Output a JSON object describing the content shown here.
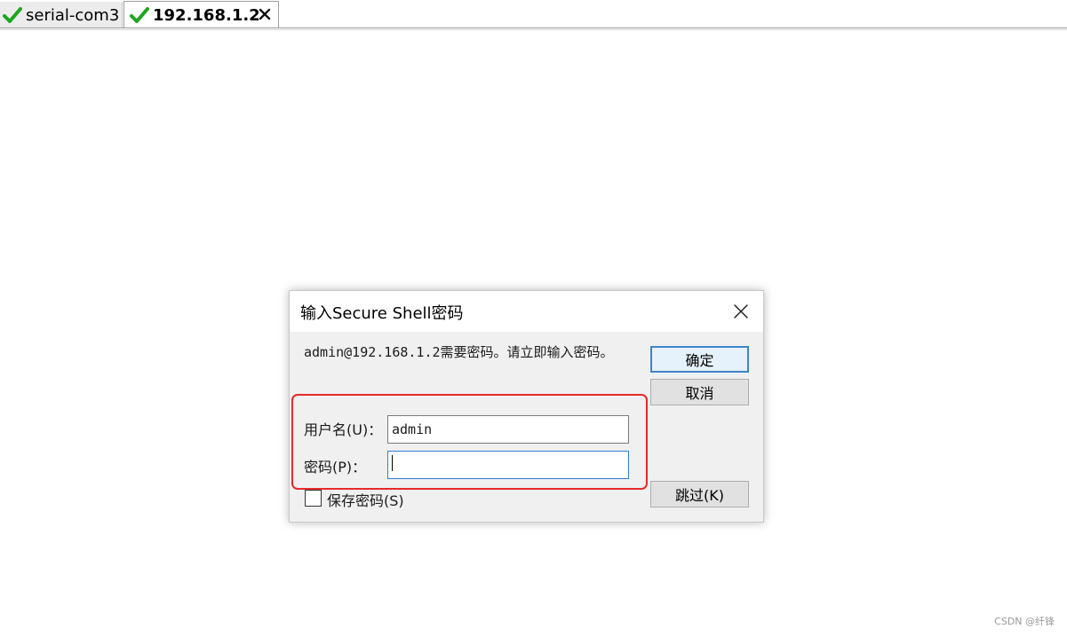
{
  "tabs": [
    {
      "label": "serial-com3",
      "status_icon": "check-icon",
      "active": false
    },
    {
      "label": "192.168.1.2",
      "status_icon": "check-icon",
      "active": true,
      "close_icon": "close-icon"
    }
  ],
  "dialog": {
    "title": "输入Secure Shell密码",
    "close_icon": "close-icon",
    "message": "admin@192.168.1.2需要密码。请立即输入密码。",
    "username_label": "用户名(U)：",
    "username_value": "admin",
    "password_label": "密码(P)：",
    "password_value": "",
    "save_password_label": "保存密码(S)",
    "save_password_checked": false,
    "ok_label": "确定",
    "cancel_label": "取消",
    "skip_label": "跳过(K)"
  },
  "watermark": "CSDN @纤锋",
  "colors": {
    "check": "#1fa51f",
    "highlight_border": "#e82a2a",
    "focus_border": "#2f7fd1",
    "dialog_bg": "#f0f0f0"
  }
}
